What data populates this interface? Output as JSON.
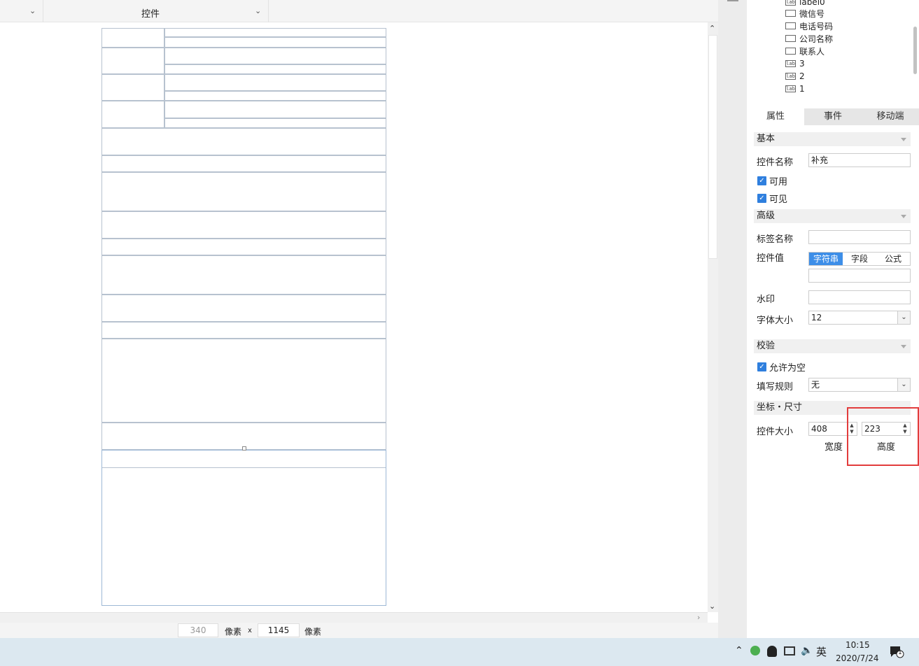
{
  "toolbar": {
    "left_dropdown_chevron": "chevron-down",
    "main_dropdown_label": "控件"
  },
  "tree": {
    "items": [
      {
        "icon": "lab",
        "label": "label0"
      },
      {
        "icon": "box",
        "label": "微信号"
      },
      {
        "icon": "box",
        "label": "电话号码"
      },
      {
        "icon": "box",
        "label": "公司名称"
      },
      {
        "icon": "box",
        "label": "联系人"
      },
      {
        "icon": "lab",
        "label": "3"
      },
      {
        "icon": "lab",
        "label": "2"
      },
      {
        "icon": "lab",
        "label": "1"
      }
    ]
  },
  "tabs": {
    "properties": "属性",
    "events": "事件",
    "mobile": "移动端"
  },
  "basic": {
    "header": "基本",
    "control_name_label": "控件名称",
    "control_name_value": "补充",
    "enabled_label": "可用",
    "visible_label": "可见"
  },
  "advanced": {
    "header": "高级",
    "tag_name_label": "标签名称",
    "tag_name_value": "",
    "control_value_label": "控件值",
    "value_modes": [
      "字符串",
      "字段",
      "公式"
    ],
    "watermark_label": "水印",
    "watermark_value": "",
    "font_size_label": "字体大小",
    "font_size_value": "12"
  },
  "validation": {
    "header": "校验",
    "allow_empty_label": "允许为空",
    "rule_label": "填写规则",
    "rule_value": "无"
  },
  "geometry": {
    "header": "坐标・尺寸",
    "size_label": "控件大小",
    "width_value": "408",
    "height_value": "223",
    "width_caption": "宽度",
    "height_caption": "高度"
  },
  "sizebar": {
    "width_value": "340",
    "unit1": "像素",
    "times": "x",
    "height_value": "1145",
    "unit2": "像素"
  },
  "taskbar": {
    "ime": "英",
    "time": "10:15",
    "date": "2020/7/24",
    "notification_count": "1"
  }
}
